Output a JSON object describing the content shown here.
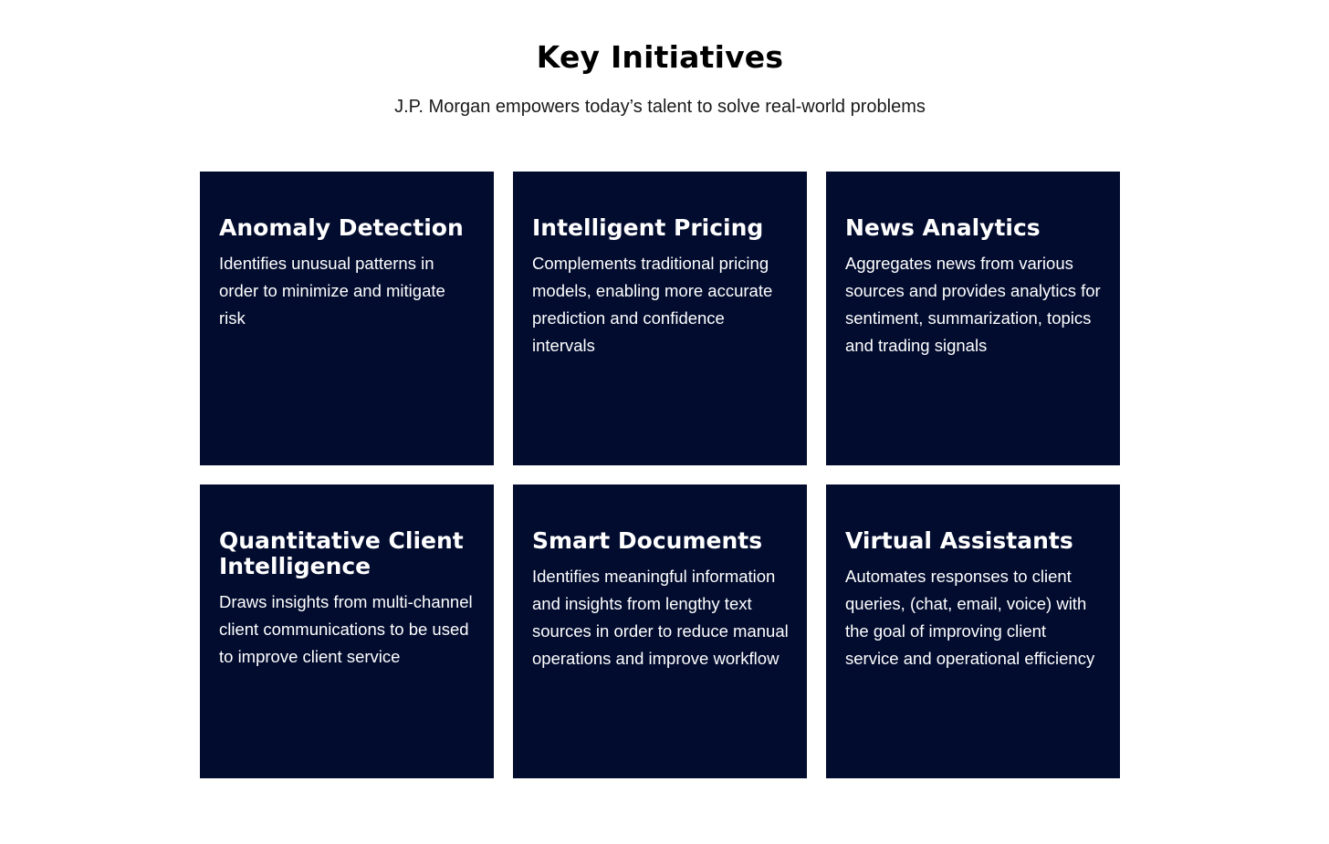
{
  "header": {
    "title": "Key Initiatives",
    "subtitle": "J.P. Morgan empowers today’s talent to solve real-world problems"
  },
  "colors": {
    "card_background": "#020c2f",
    "card_text": "#ffffff",
    "page_background": "#ffffff"
  },
  "initiatives": [
    {
      "title": "Anomaly Detection",
      "description": "Identifies unusual patterns in order to minimize and mitigate risk"
    },
    {
      "title": "Intelligent Pricing",
      "description": "Complements traditional pricing models, enabling more accurate prediction and confidence intervals"
    },
    {
      "title": "News Analytics",
      "description": "Aggregates news from various sources and provides analytics for sentiment, summarization, topics and trading signals"
    },
    {
      "title": "Quantitative Client Intelligence",
      "description": "Draws insights from multi-channel client communications to be used to improve client service"
    },
    {
      "title": "Smart Documents",
      "description": "Identifies meaningful information and insights from lengthy text sources in order to reduce manual operations and improve workflow"
    },
    {
      "title": "Virtual Assistants",
      "description": "Automates responses to client queries, (chat, email, voice) with the goal of improving client service and operational efficiency"
    }
  ]
}
